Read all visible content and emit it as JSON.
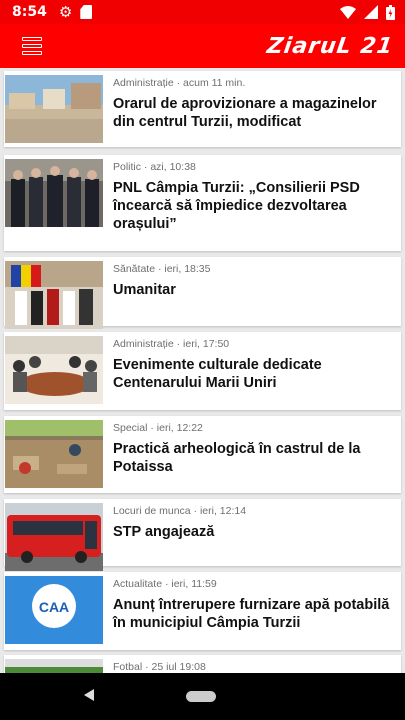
{
  "status": {
    "time": "8:54"
  },
  "app": {
    "brand": "ZiaruL 21",
    "accent": "#ff0000"
  },
  "articles": [
    {
      "meta": "Administrație · acum 11 min.",
      "title": "Orarul de aprovizionare a magazinelor din centrul Turzii, modificat",
      "thumb": "town-square-photo"
    },
    {
      "meta": "Politic · azi, 10:38",
      "title": "PNL Câmpia Turzii: „Consilierii PSD încearcă să împiedice dezvoltarea orașului”",
      "thumb": "press-conference-photo"
    },
    {
      "meta": "Sănătate · ieri, 18:35",
      "title": "Umanitar",
      "thumb": "parade-photo"
    },
    {
      "meta": "Administrație · ieri, 17:50",
      "title": "Evenimente culturale dedicate Centenarului Marii Uniri",
      "thumb": "meeting-room-photo"
    },
    {
      "meta": "Special · ieri, 12:22",
      "title": "Practică arheologică în castrul de la Potaissa",
      "thumb": "excavation-photo"
    },
    {
      "meta": "Locuri de munca · ieri, 12:14",
      "title": "STP angajează",
      "thumb": "red-bus-photo"
    },
    {
      "meta": "Actualitate · ieri, 11:59",
      "title": "Anunț întrerupere furnizare apă potabilă în municipiul Câmpia Turzii",
      "thumb": "water-company-logo"
    },
    {
      "meta": "Fotbal · 25 iul 19:08",
      "title": "",
      "thumb": "football-field-photo"
    }
  ]
}
